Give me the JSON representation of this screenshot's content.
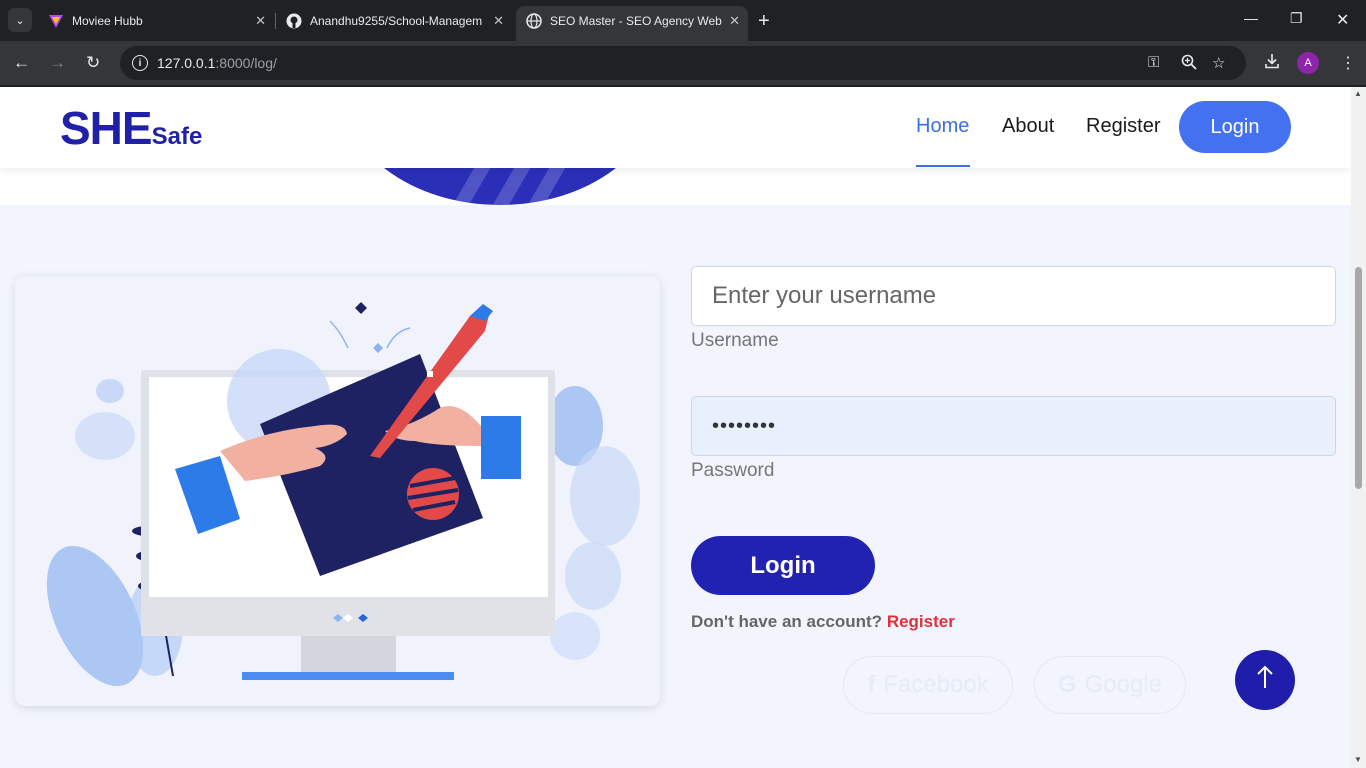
{
  "browser": {
    "tabs": [
      {
        "title": "Moviee Hubb",
        "active": false
      },
      {
        "title": "Anandhu9255/School-Managem",
        "active": false
      },
      {
        "title": "SEO Master - SEO Agency Web",
        "active": true
      }
    ],
    "url_host": "127.0.0.1",
    "url_rest": ":8000/log/",
    "profile_initial": "A"
  },
  "navbar": {
    "logo_big": "SHE",
    "logo_small": "Safe",
    "links": [
      "Home",
      "About",
      "Register"
    ],
    "active_link": "Home",
    "login_label": "Login"
  },
  "form": {
    "username_placeholder": "Enter your username",
    "username_label": "Username",
    "password_value": "••••••••",
    "password_label": "Password",
    "login_label": "Login",
    "no_account_text": "Don't have an account?",
    "register_link": "Register",
    "social": [
      {
        "name": "Facebook",
        "icon": "facebook-icon"
      },
      {
        "name": "Google",
        "icon": "google-icon"
      }
    ]
  },
  "colors": {
    "brand": "#1f22a8",
    "accent": "#4471ef",
    "button": "#2222b2",
    "link_red": "#e0303b",
    "page_bg": "#f2f5fd"
  }
}
